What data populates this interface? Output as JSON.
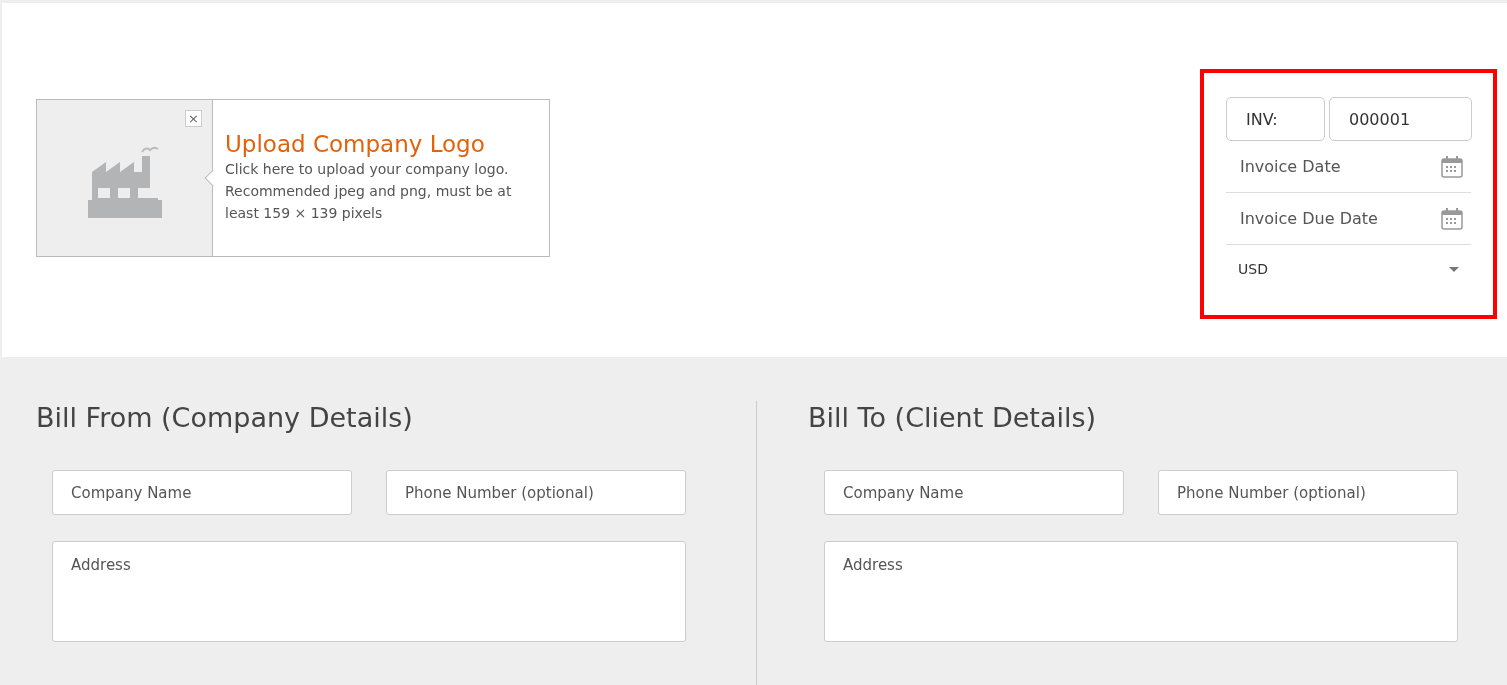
{
  "logo_upload": {
    "title": "Upload Company Logo",
    "description": "Click here to upload your company logo. Recommended jpeg and png, must be at least 159 × 139 pixels",
    "close_label": "×"
  },
  "invoice_panel": {
    "highlighted": true,
    "prefix": "INV:",
    "number": "000001",
    "invoice_date": {
      "placeholder": "Invoice Date"
    },
    "due_date": {
      "placeholder": "Invoice Due Date"
    },
    "currency": "USD"
  },
  "sections": [
    {
      "title": "Bill From (Company Details)",
      "company_name": {
        "placeholder": "Company Name"
      },
      "phone": {
        "placeholder": "Phone Number (optional)"
      },
      "address": {
        "placeholder": "Address"
      }
    },
    {
      "title": "Bill To (Client Details)",
      "company_name": {
        "placeholder": "Company Name"
      },
      "phone": {
        "placeholder": "Phone Number (optional)"
      },
      "address": {
        "placeholder": "Address"
      }
    }
  ]
}
